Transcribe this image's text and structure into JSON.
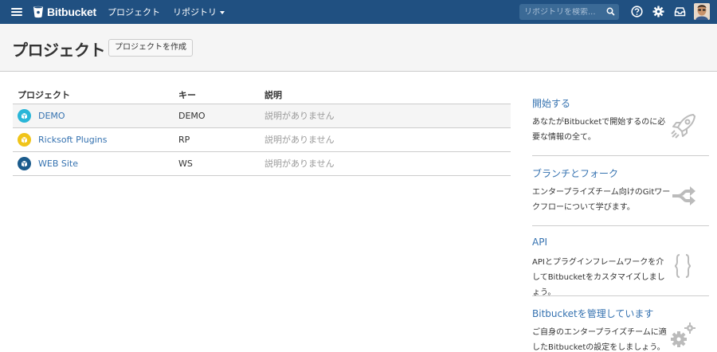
{
  "nav": {
    "brand": "Bitbucket",
    "projects": "プロジェクト",
    "repositories": "リポジトリ",
    "search_placeholder": "リポジトリを検索...",
    "help_icon": "help-icon",
    "settings_icon": "gear-icon",
    "inbox_icon": "inbox-icon"
  },
  "header": {
    "title": "プロジェクト",
    "create_button": "プロジェクトを作成"
  },
  "table": {
    "columns": [
      "プロジェクト",
      "キー",
      "説明"
    ],
    "rows": [
      {
        "name": "DEMO",
        "key": "DEMO",
        "description": "説明がありません",
        "avatar_color": "#29b6d8"
      },
      {
        "name": "Ricksoft Plugins",
        "key": "RP",
        "description": "説明がありません",
        "avatar_color": "#f0c419"
      },
      {
        "name": "WEB Site",
        "key": "WS",
        "description": "説明がありません",
        "avatar_color": "#1b5b8c"
      }
    ]
  },
  "sidebar": {
    "tips": [
      {
        "title": "開始する",
        "text": "あなたがBitbucketで開始するのに必要な情報の全て。",
        "icon": "rocket-icon"
      },
      {
        "title": "ブランチとフォーク",
        "text": "エンタープライズチーム向けのGitワークフローについて学びます。",
        "icon": "branch-icon"
      },
      {
        "title": "API",
        "text": "APIとプラグインフレームワークを介してBitbucketをカスタマイズしましょう。",
        "icon": "curly-braces-icon"
      },
      {
        "title": "Bitbucketを管理しています",
        "text": "ご自身のエンタープライズチームに適したBitbucketの設定をしましょう。",
        "icon": "gears-icon"
      }
    ]
  },
  "colors": {
    "nav_bg": "#205081",
    "link": "#3572b0",
    "header_bg": "#f5f5f5"
  }
}
